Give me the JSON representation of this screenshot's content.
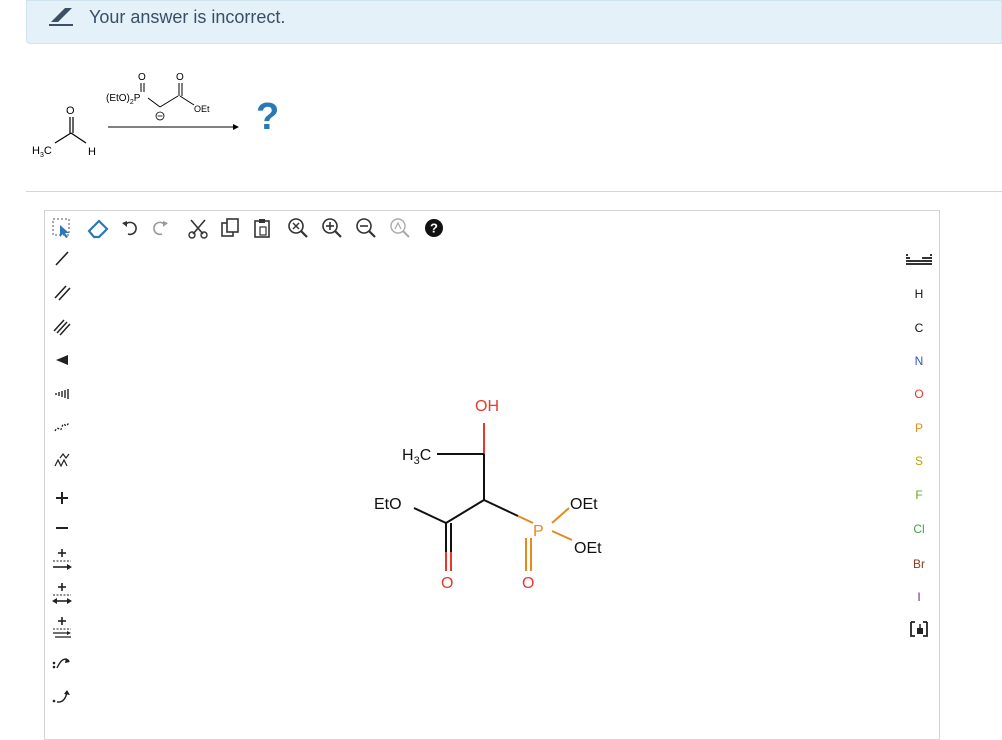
{
  "feedback": {
    "message": "Your answer is incorrect.",
    "icon": "pencil-icon"
  },
  "reaction": {
    "reactant_labels": {
      "carbonyl_o": "O",
      "methyl": "H3C",
      "hydrogen": "H"
    },
    "reagent_labels": {
      "phosphonate": "(EtO)2P",
      "o1": "O",
      "o2": "O",
      "ester": "OEt"
    },
    "product": "?"
  },
  "toolbar": {
    "top_tools": [
      "select-arrow-icon",
      "eraser-icon",
      "undo-icon",
      "redo-icon",
      "cut-icon",
      "copy-icon",
      "paste-icon",
      "zoom-fit-icon",
      "zoom-in-icon",
      "zoom-out-icon",
      "clean-icon",
      "help-icon"
    ],
    "left_tools": [
      "single-bond-icon",
      "double-bond-icon",
      "triple-bond-icon",
      "wedge-bond-icon",
      "hash-bond-icon",
      "wavy-bond-icon",
      "chain-icon",
      "plus-charge-icon",
      "minus-charge-icon",
      "lone-pair-icon",
      "radical-icon",
      "reaction-arrow-icon",
      "electron-pair-arrow-icon",
      "single-electron-arrow-icon"
    ],
    "plus_label": "+",
    "minus_label": "−"
  },
  "molecule": {
    "oh": "OH",
    "methyl": "H3C",
    "eto": "EtO",
    "oet1": "OEt",
    "oet2": "OEt",
    "p": "P",
    "o_ester": "O",
    "o_p": "O"
  },
  "elements": [
    "H",
    "C",
    "N",
    "O",
    "P",
    "S",
    "F",
    "Cl",
    "Br",
    "I"
  ],
  "colors": {
    "accent_blue": "#2a78b8",
    "oxygen_red": "#e8382b",
    "phosphorus_orange": "#e58a1f",
    "nitrogen_blue": "#3355cc",
    "sulfur_olive": "#b7a400",
    "fluorine_green": "#6aa52c",
    "chlorine_green": "#43a14b",
    "bromine_brown": "#8b3a1a",
    "iodine_purple": "#6e2a8a"
  }
}
